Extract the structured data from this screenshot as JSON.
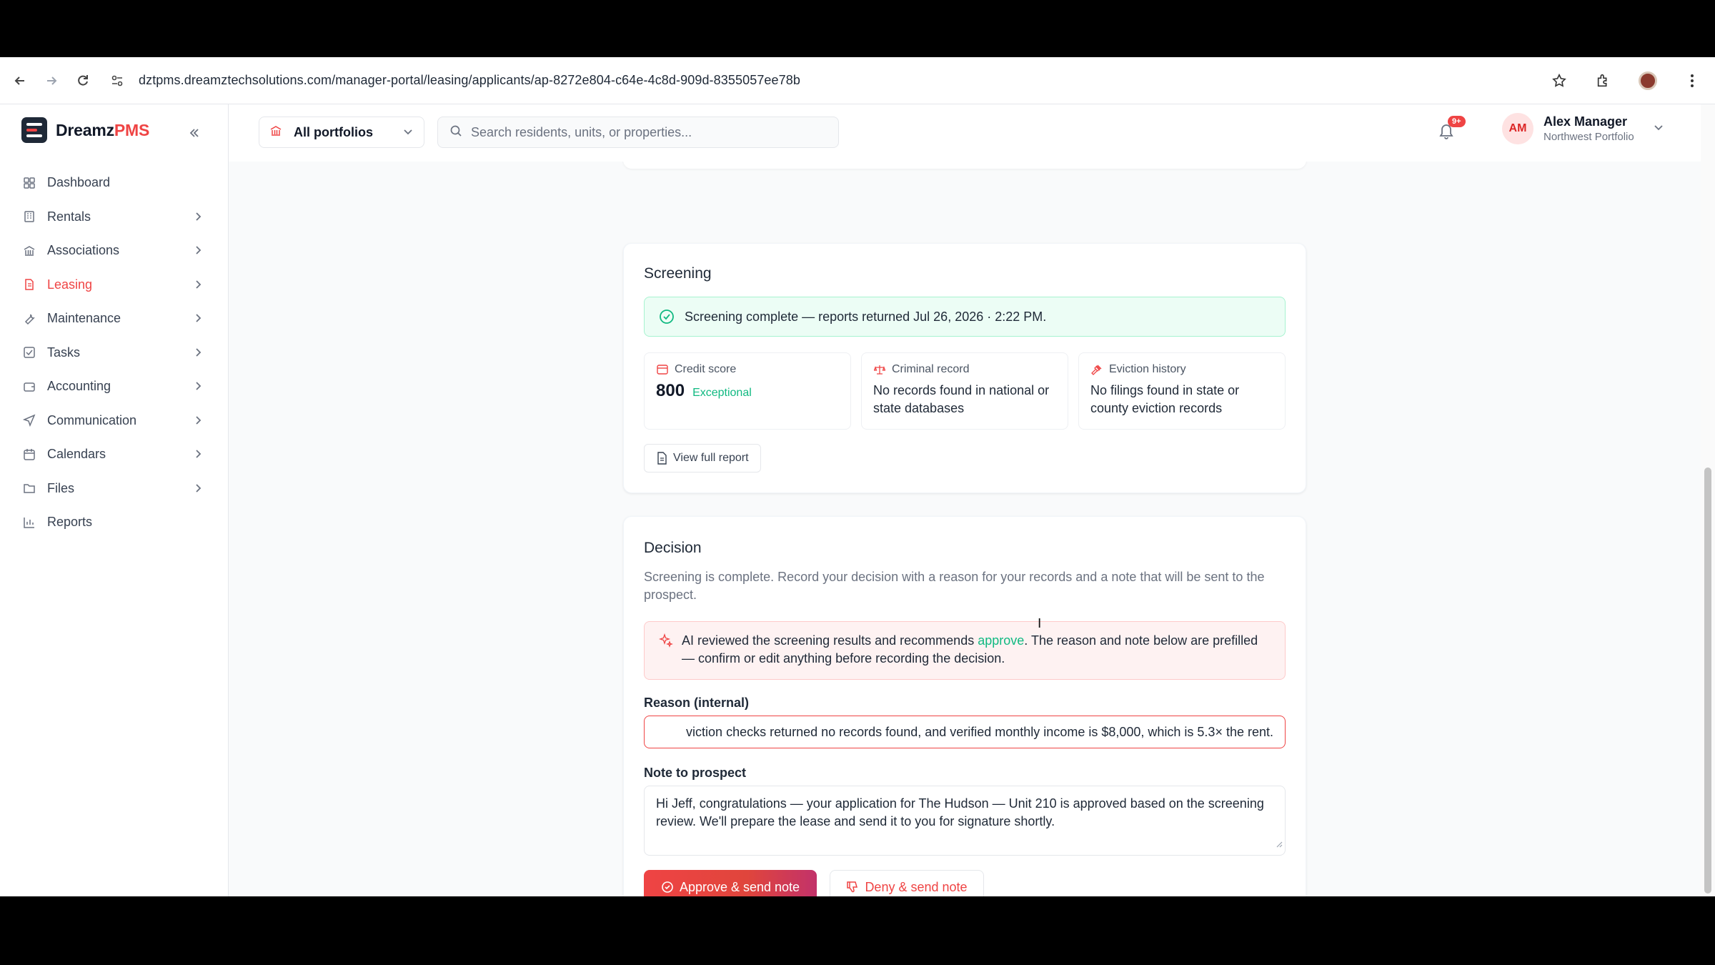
{
  "browser": {
    "url": "dztpms.dreamztechsolutions.com/manager-portal/leasing/applicants/ap-8272e804-c64e-4c8d-909d-8355057ee78b"
  },
  "brand": {
    "name_main": "Dreamz",
    "name_accent": "PMS"
  },
  "sidebar": {
    "items": [
      {
        "label": "Dashboard"
      },
      {
        "label": "Rentals"
      },
      {
        "label": "Associations"
      },
      {
        "label": "Leasing"
      },
      {
        "label": "Maintenance"
      },
      {
        "label": "Tasks"
      },
      {
        "label": "Accounting"
      },
      {
        "label": "Communication"
      },
      {
        "label": "Calendars"
      },
      {
        "label": "Files"
      },
      {
        "label": "Reports"
      }
    ],
    "active": "Leasing"
  },
  "header": {
    "portfolio": "All portfolios",
    "search_placeholder": "Search residents, units, or properties...",
    "notifications_badge": "9+",
    "user_initials": "AM",
    "user_name": "Alex Manager",
    "user_sub": "Northwest Portfolio"
  },
  "screening": {
    "title": "Screening",
    "status": "Screening complete — reports returned Jul 26, 2026 · 2:22 PM.",
    "credit_label": "Credit score",
    "credit_score": "800",
    "credit_rating": "Exceptional",
    "criminal_label": "Criminal record",
    "criminal_text": "No records found in national or state databases",
    "eviction_label": "Eviction history",
    "eviction_text": "No filings found in state or county eviction records",
    "view_report": "View full report"
  },
  "decision": {
    "title": "Decision",
    "description": "Screening is complete. Record your decision with a reason for your records and a note that will be sent to the prospect.",
    "ai_prefix": "AI reviewed the screening results and recommends ",
    "ai_recommendation": "approve",
    "ai_suffix": ". The reason and note below are prefilled — confirm or edit anything before recording the decision.",
    "reason_label": "Reason (internal)",
    "reason_value": "viction checks returned no records found, and verified monthly income is $8,000, which is 5.3× the rent.",
    "note_label": "Note to prospect",
    "note_value": "Hi Jeff, congratulations — your application for The Hudson — Unit 210 is approved based on the screening review. We'll prepare the lease and send it to you for signature shortly.",
    "approve_button": "Approve & send note",
    "deny_button": "Deny & send note"
  },
  "colors": {
    "accent": "#ef4444",
    "success": "#10b981",
    "success_bg": "#ecfdf5",
    "ai_bg": "#fef2f2"
  }
}
